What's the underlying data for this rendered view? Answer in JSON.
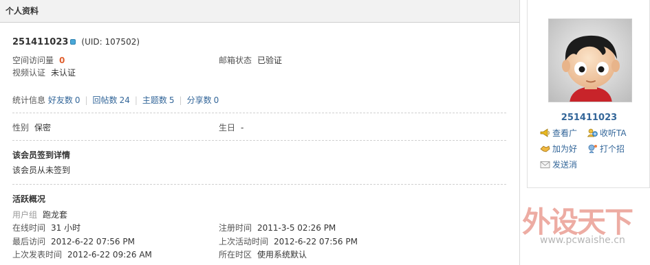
{
  "header": {
    "title": "个人资料"
  },
  "profile": {
    "username": "251411023",
    "uid": "(UID: 107502)",
    "visits_label": "空间访问量",
    "visits_value": "0",
    "email_label": "邮箱状态",
    "email_value": "已验证",
    "video_label": "视频认证",
    "video_value": "未认证"
  },
  "stats": {
    "label": "统计信息",
    "friends_label": "好友数",
    "friends_value": "0",
    "posts_label": "回帖数",
    "posts_value": "24",
    "threads_label": "主题数",
    "threads_value": "5",
    "shares_label": "分享数",
    "shares_value": "0"
  },
  "basic": {
    "gender_label": "性别",
    "gender_value": "保密",
    "birthday_label": "生日",
    "birthday_value": "-"
  },
  "signin": {
    "title": "该会员签到详情",
    "text": "该会员从未签到"
  },
  "activity": {
    "title": "活跃概况",
    "group_label": "用户组",
    "group_value": "跑龙套",
    "online_label": "在线时间",
    "online_value": "31 小时",
    "register_label": "注册时间",
    "register_value": "2011-3-5 02:26 PM",
    "last_visit_label": "最后访问",
    "last_visit_value": "2012-6-22 07:56 PM",
    "last_active_label": "上次活动时间",
    "last_active_value": "2012-6-22 07:56 PM",
    "last_post_label": "上次发表时间",
    "last_post_value": "2012-6-22 09:26 AM",
    "timezone_label": "所在时区",
    "timezone_value": "使用系统默认"
  },
  "sidebar": {
    "name": "251411023",
    "actions": [
      {
        "label": "查看广",
        "icon": "megaphone-icon"
      },
      {
        "label": "收听TA",
        "icon": "follow-icon"
      },
      {
        "label": "加为好",
        "icon": "handshake-icon"
      },
      {
        "label": "打个招",
        "icon": "poke-icon"
      },
      {
        "label": "发送消",
        "icon": "envelope-icon"
      }
    ]
  },
  "watermark": {
    "title": "外设天下",
    "url": "www.pcwaishe.cn"
  },
  "colors": {
    "link": "#336699",
    "visits": "#e06030",
    "header_bg": "#f2f2f2",
    "watermark": "#d64834"
  }
}
